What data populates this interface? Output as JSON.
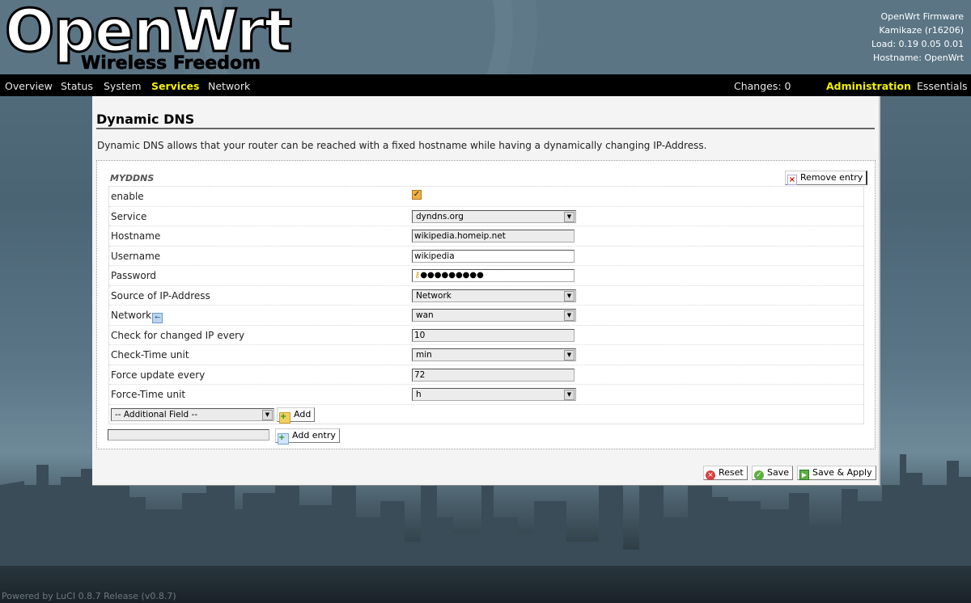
{
  "header": {
    "logo_title": "OpenWrt",
    "logo_subtitle": "Wireless Freedom",
    "sysinfo": {
      "firmware": "OpenWrt Firmware",
      "release": "Kamikaze (r16206)",
      "load": "Load: 0.19 0.05 0.01",
      "hostname": "Hostname: OpenWrt"
    }
  },
  "nav": {
    "items": [
      {
        "label": "Overview",
        "active": false
      },
      {
        "label": "Status",
        "active": false
      },
      {
        "label": "System",
        "active": false
      },
      {
        "label": "Services",
        "active": true
      },
      {
        "label": "Network",
        "active": false
      }
    ],
    "changes": "Changes: 0",
    "modes": [
      {
        "label": "Administration",
        "active": true
      },
      {
        "label": "Essentials",
        "active": false
      }
    ],
    "active_color": "#f0f000"
  },
  "page": {
    "title": "Dynamic DNS",
    "description": "Dynamic DNS allows that your router can be reached with a fixed hostname while having a dynamically changing IP-Address."
  },
  "section": {
    "name": "MYDDNS",
    "remove_label": "Remove entry",
    "fields": [
      {
        "label": "enable",
        "type": "checkbox",
        "checked": true
      },
      {
        "label": "Service",
        "type": "select",
        "value": "dyndns.org"
      },
      {
        "label": "Hostname",
        "type": "text",
        "value": "wikipedia.homeip.net"
      },
      {
        "label": "Username",
        "type": "text",
        "value": "wikipedia"
      },
      {
        "label": "Password",
        "type": "password",
        "value": "●●●●●●●●●"
      },
      {
        "label": "Source of IP-Address",
        "type": "select",
        "value": "Network"
      },
      {
        "label": "Network",
        "type": "select",
        "value": "wan"
      },
      {
        "label": "Check for changed IP every",
        "type": "text",
        "value": "10"
      },
      {
        "label": "Check-Time unit",
        "type": "select",
        "value": "min"
      },
      {
        "label": "Force update every",
        "type": "text",
        "value": "72"
      },
      {
        "label": "Force-Time unit",
        "type": "select",
        "value": "h"
      }
    ],
    "additional_field_placeholder": "-- Additional Field --",
    "add_label": "Add"
  },
  "new_entry": {
    "value": "",
    "add_entry_label": "Add entry"
  },
  "actions": {
    "reset": "Reset",
    "save": "Save",
    "save_apply": "Save & Apply"
  },
  "footer": "Powered by LuCI 0.8.7 Release (v0.8.7)"
}
